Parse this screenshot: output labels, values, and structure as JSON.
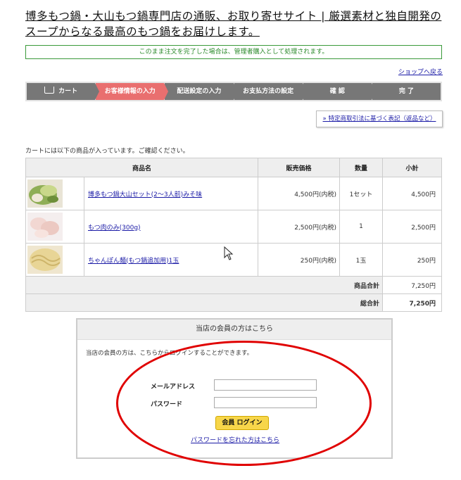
{
  "site_title": "博多もつ鍋・大山もつ鍋専門店の通販、お取り寄せサイト | 厳選素材と独自開発のスープからなる最高のもつ鍋をお届けします。",
  "notice": "このまま注文を完了した場合は、管理者購入として処理されます。",
  "back_link": "ショップへ戻る",
  "steps": [
    {
      "label": "カート",
      "icon": "cart-icon"
    },
    {
      "label": "お客様情報の入力"
    },
    {
      "label": "配送設定の入力"
    },
    {
      "label": "お支払方法の設定"
    },
    {
      "label": "確 認"
    },
    {
      "label": "完 了"
    }
  ],
  "active_step": 1,
  "law_link": "» 特定商取引法に基づく表記（返品など）",
  "cart_intro": "カートには以下の商品が入っています。ご確認ください。",
  "table": {
    "headers": {
      "name": "商品名",
      "price": "販売価格",
      "qty": "数量",
      "subtotal": "小計"
    },
    "items": [
      {
        "name": "博多もつ鍋大山セット(2〜3人前)みそ味",
        "price": "4,500円(内税)",
        "qty": "1セット",
        "subtotal": "4,500円"
      },
      {
        "name": "もつ肉のみ(300g)",
        "price": "2,500円(内税)",
        "qty": "1",
        "subtotal": "2,500円"
      },
      {
        "name": "ちゃんぽん麺(もつ鍋追加用)1玉",
        "price": "250円(内税)",
        "qty": "1玉",
        "subtotal": "250円"
      }
    ],
    "product_total_label": "商品合計",
    "product_total": "7,250円",
    "grand_total_label": "総合計",
    "grand_total": "7,250円"
  },
  "member": {
    "title": "当店の会員の方はこちら",
    "desc": "当店の会員の方は、こちらからログインすることができます。",
    "email_label": "メールアドレス",
    "password_label": "パスワード",
    "login_button": "会員 ログイン",
    "forgot_link": "パスワードを忘れた方はこちら"
  },
  "colors": {
    "active_step": "#e96f6f",
    "inactive_step": "#777777",
    "notice": "#2b8a2b",
    "highlight_ellipse": "#e00000"
  }
}
